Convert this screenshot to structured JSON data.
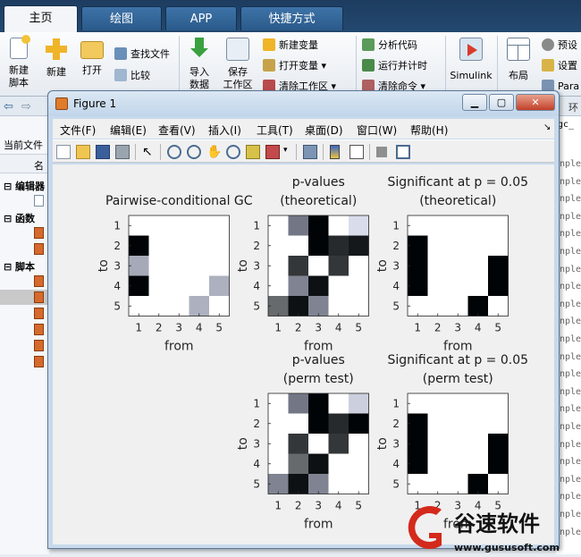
{
  "ribbon": {
    "tabs": [
      "主页",
      "绘图",
      "APP",
      "快捷方式"
    ],
    "new_script": "新建\n脚本",
    "new": "新建",
    "open": "打开",
    "find_files": "查找文件",
    "compare": "比较",
    "import": "导入\n数据",
    "save_workspace": "保存\n工作区",
    "new_variable": "新建变量",
    "open_variable": "打开变量",
    "clear_workspace": "清除工作区",
    "analyze_code": "分析代码",
    "run_timed": "运行并计时",
    "clear_commands": "清除命令",
    "simulink": "Simulink",
    "layout": "布局",
    "prefs": "预设",
    "set_path": "设置",
    "parallel": "Para"
  },
  "left_panel": {
    "current_folder": "当前文件",
    "name_col": "名",
    "sec_editor": "编辑器",
    "sec_functions": "函数",
    "sec_scripts": "脚本"
  },
  "right_panel": {
    "env_label": "环",
    "gc_label": "gc_",
    "cmd_lines": [
      "nple",
      "nple",
      "nple",
      "nple",
      "nple",
      "nple",
      "nple",
      "nple",
      "nple",
      "nple",
      "nple",
      "nple",
      "nple",
      "nple",
      "nple",
      "nple",
      "nple",
      "nple",
      "nple",
      "nple",
      "nple",
      "nple"
    ]
  },
  "figure": {
    "title": "Figure 1",
    "menu": [
      "文件(F)",
      "编辑(E)",
      "查看(V)",
      "插入(I)",
      "工具(T)",
      "桌面(D)",
      "窗口(W)",
      "帮助(H)"
    ]
  },
  "chart_data": [
    {
      "type": "heatmap",
      "title": "Pairwise-conditional GC",
      "xlabel": "from",
      "ylabel": "to",
      "x": [
        1,
        2,
        3,
        4,
        5
      ],
      "y": [
        1,
        2,
        3,
        4,
        5
      ],
      "values": [
        [
          0,
          0,
          0,
          0,
          0
        ],
        [
          1,
          0,
          0,
          0,
          0
        ],
        [
          0.35,
          0,
          0,
          0,
          0
        ],
        [
          1,
          0,
          0,
          0,
          0.32
        ],
        [
          0,
          0,
          0,
          0.32,
          0
        ]
      ],
      "colormap": "white-to-black"
    },
    {
      "type": "heatmap",
      "title": "p-values\n(theoretical)",
      "xlabel": "from",
      "ylabel": "to",
      "x": [
        1,
        2,
        3,
        4,
        5
      ],
      "y": [
        1,
        2,
        3,
        4,
        5
      ],
      "values": [
        [
          0,
          0.55,
          1,
          0,
          0.15
        ],
        [
          0,
          0,
          1,
          0.85,
          0.92
        ],
        [
          0,
          0.8,
          0,
          0.8,
          0
        ],
        [
          0,
          0.5,
          0.95,
          0,
          0
        ],
        [
          0.6,
          0.95,
          0.5,
          0,
          0
        ]
      ],
      "colormap": "white-to-black"
    },
    {
      "type": "heatmap",
      "title": "Significant at p = 0.05\n(theoretical)",
      "xlabel": "from",
      "ylabel": "to",
      "x": [
        1,
        2,
        3,
        4,
        5
      ],
      "y": [
        1,
        2,
        3,
        4,
        5
      ],
      "values": [
        [
          0,
          0,
          0,
          0,
          0
        ],
        [
          1,
          0,
          0,
          0,
          0
        ],
        [
          1,
          0,
          0,
          0,
          1
        ],
        [
          1,
          0,
          0,
          0,
          1
        ],
        [
          0,
          0,
          0,
          1,
          0
        ]
      ],
      "colormap": "white-to-black"
    },
    {
      "type": "heatmap",
      "title": "p-values\n(perm test)",
      "xlabel": "from",
      "ylabel": "to",
      "x": [
        1,
        2,
        3,
        4,
        5
      ],
      "y": [
        1,
        2,
        3,
        4,
        5
      ],
      "values": [
        [
          0,
          0.55,
          1,
          0,
          0.2
        ],
        [
          0,
          0,
          1,
          0.85,
          1
        ],
        [
          0,
          0.8,
          0,
          0.8,
          0
        ],
        [
          0,
          0.6,
          0.95,
          0,
          0
        ],
        [
          0.5,
          0.95,
          0.5,
          0,
          0
        ]
      ],
      "colormap": "white-to-black"
    },
    {
      "type": "heatmap",
      "title": "Significant at p = 0.05\n(perm test)",
      "xlabel": "from",
      "ylabel": "to",
      "x": [
        1,
        2,
        3,
        4,
        5
      ],
      "y": [
        1,
        2,
        3,
        4,
        5
      ],
      "values": [
        [
          0,
          0,
          0,
          0,
          0
        ],
        [
          1,
          0,
          0,
          0,
          0
        ],
        [
          1,
          0,
          0,
          0,
          1
        ],
        [
          1,
          0,
          0,
          0,
          1
        ],
        [
          0,
          0,
          0,
          1,
          0
        ]
      ],
      "colormap": "white-to-black"
    }
  ],
  "watermark": {
    "text": "谷速软件",
    "url": "www.gususoft.com"
  }
}
